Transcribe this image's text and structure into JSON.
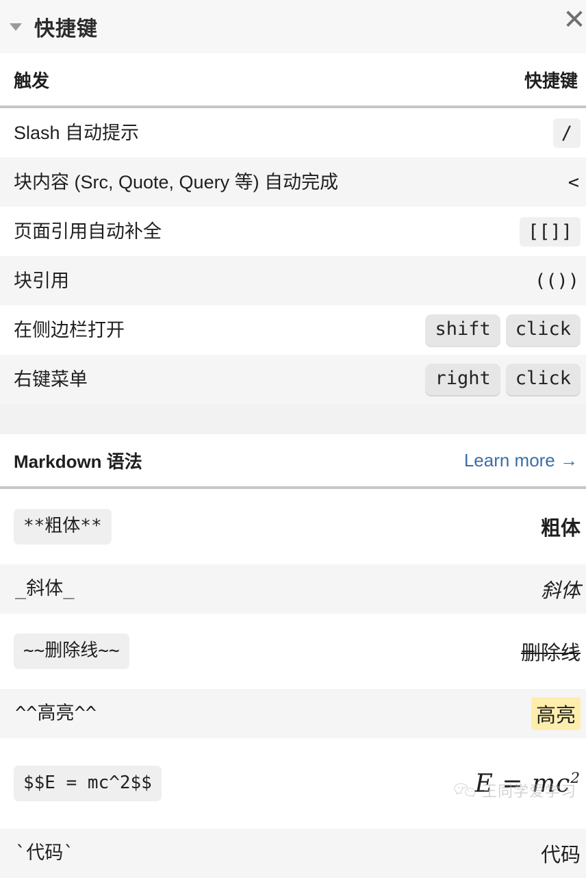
{
  "panel": {
    "title": "快捷键",
    "collapse_icon": "triangle-down-icon",
    "close_icon": "close-icon"
  },
  "shortcuts_table": {
    "header": {
      "trigger": "触发",
      "shortcut": "快捷键"
    },
    "rows": [
      {
        "trigger": "Slash 自动提示",
        "shortcut": "/",
        "style": "code"
      },
      {
        "trigger": "块内容 (Src, Quote, Query 等) 自动完成",
        "shortcut": "<",
        "style": "plain"
      },
      {
        "trigger": "页面引用自动补全",
        "shortcut": "[[]]",
        "style": "code"
      },
      {
        "trigger": "块引用",
        "shortcut": "(())",
        "style": "plain"
      },
      {
        "trigger": "在侧边栏打开",
        "keys": [
          "shift",
          "click"
        ],
        "style": "kbd"
      },
      {
        "trigger": "右键菜单",
        "keys": [
          "right",
          "click"
        ],
        "style": "kbd"
      }
    ]
  },
  "markdown_table": {
    "header": {
      "title": "Markdown 语法",
      "link": "Learn more →"
    },
    "rows": [
      {
        "syntax": "**粗体**",
        "syntax_style": "code",
        "result": "粗体",
        "result_style": "bold"
      },
      {
        "syntax": "_斜体_",
        "syntax_style": "plain",
        "result": "斜体",
        "result_style": "italic"
      },
      {
        "syntax": "~~删除线~~",
        "syntax_style": "code",
        "result": "删除线",
        "result_style": "strike"
      },
      {
        "syntax": "^^高亮^^",
        "syntax_style": "plain",
        "result": "高亮",
        "result_style": "highlight"
      },
      {
        "syntax": "$$E = mc^2$$",
        "syntax_style": "code",
        "result": "E = mc",
        "result_sup": "2",
        "result_style": "latex"
      },
      {
        "syntax": "`代码`",
        "syntax_style": "plain",
        "result": "代码",
        "result_style": "code"
      }
    ]
  },
  "watermark": {
    "text": "王同学爱学习",
    "icon": "wechat-icon"
  },
  "colors": {
    "link": "#3a6ea5",
    "highlight": "#fdeeae",
    "code_bg": "#f0f0f0",
    "row_alt": "#f5f5f5",
    "page_bg": "#f2f2f2"
  }
}
